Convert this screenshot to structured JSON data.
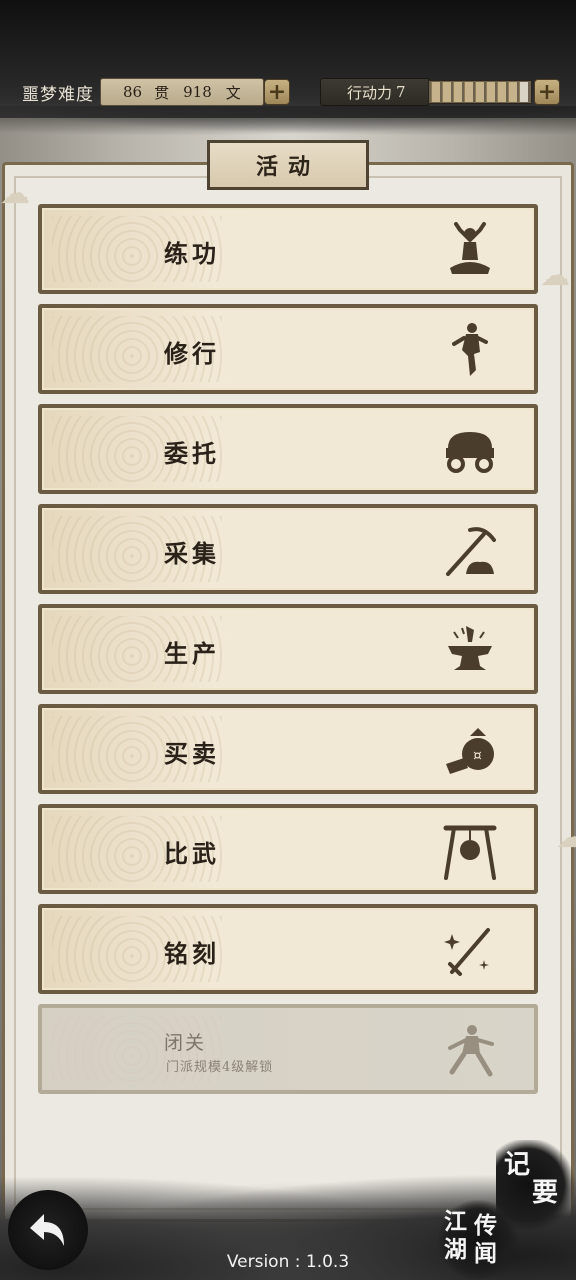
{
  "resources": {
    "difficulty_label": "噩梦难度",
    "money_guan": "86",
    "money_guan_unit": "贯",
    "money_wen": "918",
    "money_wen_unit": "文",
    "action_label": "行动力",
    "action_value": "7",
    "action_segments_filled": 8,
    "action_segments_total": 9,
    "plus_glyph": "+"
  },
  "panel": {
    "title": "活动"
  },
  "activities": [
    {
      "label": "练功",
      "icon": "meditating-figure-icon"
    },
    {
      "label": "修行",
      "icon": "training-figure-icon"
    },
    {
      "label": "委托",
      "icon": "cart-icon"
    },
    {
      "label": "采集",
      "icon": "pickaxe-icon"
    },
    {
      "label": "生产",
      "icon": "anvil-icon"
    },
    {
      "label": "买卖",
      "icon": "money-bag-icon"
    },
    {
      "label": "比武",
      "icon": "gong-icon"
    },
    {
      "label": "铭刻",
      "icon": "engraving-sword-icon"
    },
    {
      "label": "闭关",
      "sub": "门派规模4级解锁",
      "icon": "martial-pose-icon",
      "locked": true
    }
  ],
  "bottom": {
    "version": "Version : 1.0.3",
    "jiyao_1": "记",
    "jiyao_2": "要",
    "jianghu_1": "江",
    "jianghu_2": "湖",
    "jianghu_3": "传",
    "jianghu_4": "闻"
  },
  "colors": {
    "frame": "#6b5b43",
    "row_bg": "#f1e8d6",
    "text": "#2a2118",
    "locked_text": "#7d7668"
  }
}
